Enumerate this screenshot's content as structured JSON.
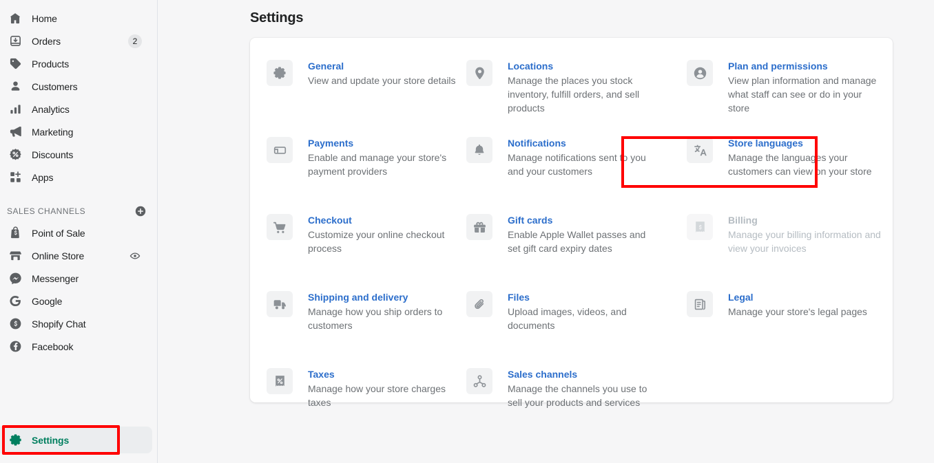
{
  "sidebar": {
    "primary_items": [
      {
        "label": "Home",
        "icon": "home-icon",
        "badge": null
      },
      {
        "label": "Orders",
        "icon": "orders-icon",
        "badge": "2"
      },
      {
        "label": "Products",
        "icon": "products-tag-icon",
        "badge": null
      },
      {
        "label": "Customers",
        "icon": "customers-person-icon",
        "badge": null
      },
      {
        "label": "Analytics",
        "icon": "analytics-bars-icon",
        "badge": null
      },
      {
        "label": "Marketing",
        "icon": "marketing-megaphone-icon",
        "badge": null
      },
      {
        "label": "Discounts",
        "icon": "discounts-percent-icon",
        "badge": null
      },
      {
        "label": "Apps",
        "icon": "apps-grid-icon",
        "badge": null
      }
    ],
    "sales_channels_label": "SALES CHANNELS",
    "add_channel_icon": "plus-circle-icon",
    "channel_items": [
      {
        "label": "Point of Sale",
        "icon": "point-of-sale-icon",
        "trailing": null
      },
      {
        "label": "Online Store",
        "icon": "online-store-icon",
        "trailing": "eye-icon"
      },
      {
        "label": "Messenger",
        "icon": "messenger-icon",
        "trailing": null
      },
      {
        "label": "Google",
        "icon": "google-icon",
        "trailing": null
      },
      {
        "label": "Shopify Chat",
        "icon": "shopify-chat-icon",
        "trailing": null
      },
      {
        "label": "Facebook",
        "icon": "facebook-icon",
        "trailing": null
      }
    ],
    "settings": {
      "label": "Settings",
      "icon": "gear-icon"
    }
  },
  "main": {
    "page_title": "Settings",
    "settings_items": [
      {
        "title": "General",
        "description": "View and update your store details",
        "icon": "gear-icon",
        "disabled": false
      },
      {
        "title": "Locations",
        "description": "Manage the places you stock inventory, fulfill orders, and sell products",
        "icon": "location-pin-icon",
        "disabled": false
      },
      {
        "title": "Plan and permissions",
        "description": "View plan information and manage what staff can see or do in your store",
        "icon": "person-circle-icon",
        "disabled": false
      },
      {
        "title": "Payments",
        "description": "Enable and manage your store's payment providers",
        "icon": "payment-card-icon",
        "disabled": false
      },
      {
        "title": "Notifications",
        "description": "Manage notifications sent to you and your customers",
        "icon": "bell-icon",
        "disabled": false
      },
      {
        "title": "Store languages",
        "description": "Manage the languages your customers can view on your store",
        "icon": "translate-icon",
        "disabled": false
      },
      {
        "title": "Checkout",
        "description": "Customize your online checkout process",
        "icon": "shopping-cart-icon",
        "disabled": false
      },
      {
        "title": "Gift cards",
        "description": "Enable Apple Wallet passes and set gift card expiry dates",
        "icon": "gift-card-icon",
        "disabled": false
      },
      {
        "title": "Billing",
        "description": "Manage your billing information and view your invoices",
        "icon": "receipt-dollar-icon",
        "disabled": true
      },
      {
        "title": "Shipping and delivery",
        "description": "Manage how you ship orders to customers",
        "icon": "delivery-truck-icon",
        "disabled": false
      },
      {
        "title": "Files",
        "description": "Upload images, videos, and documents",
        "icon": "paperclip-icon",
        "disabled": false
      },
      {
        "title": "Legal",
        "description": "Manage your store's legal pages",
        "icon": "legal-scroll-icon",
        "disabled": false
      },
      {
        "title": "Taxes",
        "description": "Manage how your store charges taxes",
        "icon": "receipt-percent-icon",
        "disabled": false
      },
      {
        "title": "Sales channels",
        "description": "Manage the channels you use to sell your products and services",
        "icon": "sales-channels-node-icon",
        "disabled": false
      }
    ]
  },
  "annotations": {
    "highlight_color": "#ff0000",
    "highlighted_elements": [
      "Notifications",
      "Settings"
    ]
  },
  "colors": {
    "page_background": "#f6f6f7",
    "card_background": "#ffffff",
    "link_blue": "#2c6ecb",
    "settings_green": "#007f5f",
    "muted_text": "#6d7175",
    "disabled_text": "#b5bcc2"
  }
}
